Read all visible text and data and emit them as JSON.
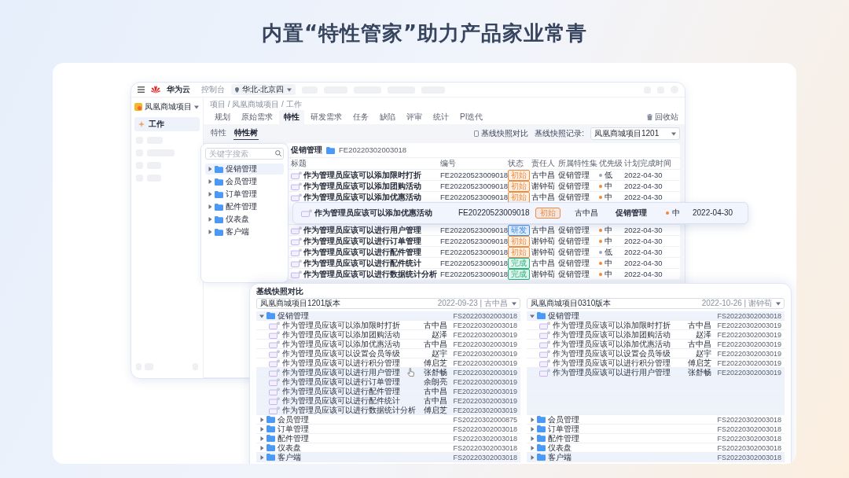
{
  "headline": "内置“特性管家”助力产品家业常青",
  "app": {
    "topbar": {
      "brand": "华为云",
      "console": "控制台",
      "region": "华北-北京四"
    },
    "sidebar": {
      "project": "凤凰商城项目",
      "items": [
        {
          "label": "工作",
          "selected": true
        }
      ]
    },
    "breadcrumb": "项目 / 凤凰商城项目 / 工作",
    "tabs": [
      {
        "label": "规划",
        "selected": false
      },
      {
        "label": "原始需求",
        "selected": false
      },
      {
        "label": "特性",
        "selected": true
      },
      {
        "label": "研发需求",
        "selected": false
      },
      {
        "label": "任务",
        "selected": false
      },
      {
        "label": "缺陷",
        "selected": false
      },
      {
        "label": "评审",
        "selected": false
      },
      {
        "label": "统计",
        "selected": false
      },
      {
        "label": "PI迭代",
        "selected": false
      }
    ],
    "recycle": "回收站",
    "subtabs": [
      {
        "label": "特性",
        "selected": false
      },
      {
        "label": "特性树",
        "selected": true
      }
    ],
    "baseline_compare": "基线快照对比",
    "baseline_record": {
      "label": "基线快照记录:",
      "value": "凤凰商城项目1201"
    },
    "tree": {
      "placeholder": "关键字搜索",
      "items": [
        {
          "label": "促销管理",
          "selected": true
        },
        {
          "label": "会员管理",
          "selected": false
        },
        {
          "label": "订单管理",
          "selected": false
        },
        {
          "label": "配件管理",
          "selected": false
        },
        {
          "label": "仪表盘",
          "selected": false
        },
        {
          "label": "客户端",
          "selected": false
        }
      ]
    },
    "detail": {
      "title": "促销管理",
      "id": "FE20220302003018",
      "columns": [
        "标题",
        "编号",
        "状态",
        "责任人",
        "所属特性集",
        "优先级",
        "计划完成时间"
      ],
      "rows": [
        {
          "kind": "feature",
          "title": "作为管理员应该可以添加限时打折",
          "id": "FE20220523009018",
          "status": {
            "label": "初始",
            "color": "#f08a3c"
          },
          "owner": "古中昌",
          "set": "促销管理",
          "priority": {
            "label": "低",
            "color": "#a0a6b3"
          },
          "due": "2022-04-30"
        },
        {
          "kind": "feature",
          "title": "作为管理员应该可以添加团购活动",
          "id": "FE20220523009018",
          "status": {
            "label": "初始",
            "color": "#f08a3c"
          },
          "owner": "谢钟荀",
          "set": "促销管理",
          "priority": {
            "label": "中",
            "color": "#f5862e"
          },
          "due": "2022-04-30"
        },
        {
          "kind": "feature",
          "title": "作为管理员应该可以添加优惠活动",
          "id": "FE20220523009018",
          "status": {
            "label": "初始",
            "color": "#f08a3c"
          },
          "owner": "古中昌",
          "set": "促销管理",
          "priority": {
            "label": "中",
            "color": "#f5862e"
          },
          "due": "2022-04-30"
        },
        {
          "kind": "covered"
        },
        {
          "kind": "covered"
        },
        {
          "kind": "feature",
          "title": "作为管理员应该可以进行用户管理",
          "id": "FE20220523009018",
          "status": {
            "label": "研发",
            "color": "#3d8ef0"
          },
          "owner": "古中昌",
          "set": "促销管理",
          "priority": {
            "label": "中",
            "color": "#f5862e"
          },
          "due": "2022-04-30"
        },
        {
          "kind": "feature",
          "title": "作为管理员应该可以进行订单管理",
          "id": "FE20220523009018",
          "status": {
            "label": "初始",
            "color": "#f08a3c"
          },
          "owner": "谢钟荀",
          "set": "促销管理",
          "priority": {
            "label": "中",
            "color": "#f5862e"
          },
          "due": "2022-04-30"
        },
        {
          "kind": "feature",
          "title": "作为管理员应该可以进行配件管理",
          "id": "FE20220523009018",
          "status": {
            "label": "初始",
            "color": "#f08a3c"
          },
          "owner": "谢钟荀",
          "set": "促销管理",
          "priority": {
            "label": "低",
            "color": "#a0a6b3"
          },
          "due": "2022-04-30"
        },
        {
          "kind": "feature",
          "title": "作为管理员应该可以进行配件统计",
          "id": "FE20220523009018",
          "status": {
            "label": "完成",
            "color": "#25b37a"
          },
          "owner": "古中昌",
          "set": "促销管理",
          "priority": {
            "label": "中",
            "color": "#f5862e"
          },
          "due": "2022-04-30"
        },
        {
          "kind": "feature",
          "title": "作为管理员应该可以进行数据统计分析",
          "id": "FE20220523009018",
          "status": {
            "label": "完成",
            "color": "#25b37a"
          },
          "owner": "谢钟荀",
          "set": "促销管理",
          "priority": {
            "label": "中",
            "color": "#f5862e"
          },
          "due": "2022-04-30"
        }
      ]
    }
  },
  "floating_row": {
    "title": "作为管理员应该可以添加优惠活动",
    "id": "FE20220523009018",
    "status": {
      "label": "初始",
      "color": "#f08a3c"
    },
    "owner": "古中昌",
    "set": "促销管理",
    "priority": {
      "label": "中",
      "color": "#f5862e"
    },
    "due": "2022-04-30"
  },
  "compare": {
    "title": "基线快照对比",
    "panes": [
      {
        "version": "凤凰商城项目1201版本",
        "meta": "2022-09-23 | 古中昌",
        "groups": [
          {
            "label": "促销管理",
            "id": "FS20220302003018",
            "expanded": true,
            "highlighted": true,
            "children": [
              {
                "kind": "item",
                "title": "作为管理员应该可以添加限时打折",
                "owner": "古中昌",
                "id": "FE20220302003018",
                "highlighted": false
              },
              {
                "kind": "item",
                "title": "作为管理员应该可以添加团购活动",
                "owner": "赵泽",
                "id": "FE20220302003019",
                "highlighted": false
              },
              {
                "kind": "item",
                "title": "作为管理员应该可以添加优惠活动",
                "owner": "古中昌",
                "id": "FE20220302003019",
                "highlighted": false
              },
              {
                "kind": "item",
                "title": "作为管理员应该可以设置会员等级",
                "owner": "赵宇",
                "id": "FE20220302003019",
                "highlighted": false
              },
              {
                "kind": "item",
                "title": "作为管理员应该可以进行积分管理",
                "owner": "傅启芝",
                "id": "FE20220302003019",
                "highlighted": false
              },
              {
                "kind": "item",
                "title": "作为管理员应该可以进行用户管理",
                "owner": "张舒畅",
                "id": "FE20220302003019",
                "highlighted": true
              },
              {
                "kind": "item",
                "title": "作为管理员应该可以进行订单管理",
                "owner": "余朗亮",
                "id": "FE20220302003019",
                "highlighted": true
              },
              {
                "kind": "item",
                "title": "作为管理员应该可以进行配件管理",
                "owner": "古中昌",
                "id": "FE20220302003019",
                "highlighted": true
              },
              {
                "kind": "item",
                "title": "作为管理员应该可以进行配件统计",
                "owner": "古中昌",
                "id": "FE20220302003019",
                "highlighted": true
              },
              {
                "kind": "item",
                "title": "作为管理员应该可以进行数据统计分析",
                "owner": "傅启芝",
                "id": "FE20220302003019",
                "highlighted": true
              }
            ]
          },
          {
            "label": "会员管理",
            "id": "FS20220302000875",
            "expanded": false,
            "highlighted": false
          },
          {
            "label": "订单管理",
            "id": "FS20220302003018",
            "expanded": false,
            "highlighted": false
          },
          {
            "label": "配件管理",
            "id": "FS20220302003018",
            "expanded": false,
            "highlighted": false
          },
          {
            "label": "仪表盘",
            "id": "FS20220302003018",
            "expanded": false,
            "highlighted": false
          },
          {
            "label": "客户端",
            "id": "FS20220302003018",
            "expanded": false,
            "highlighted": true
          }
        ]
      },
      {
        "version": "凤凰商城项目0310版本",
        "meta": "2022-10-26 | 谢钟荀",
        "groups": [
          {
            "label": "促销管理",
            "id": "FS20220302003018",
            "expanded": true,
            "highlighted": true,
            "children": [
              {
                "kind": "item",
                "title": "作为管理员应该可以添加限时打折",
                "owner": "古中昌",
                "id": "FE20220302003019",
                "highlighted": false
              },
              {
                "kind": "item",
                "title": "作为管理员应该可以添加团购活动",
                "owner": "赵泽",
                "id": "FE20220302003019",
                "highlighted": false
              },
              {
                "kind": "item",
                "title": "作为管理员应该可以添加优惠活动",
                "owner": "古中昌",
                "id": "FE20220302003019",
                "highlighted": false
              },
              {
                "kind": "item",
                "title": "作为管理员应该可以设置会员等级",
                "owner": "赵宇",
                "id": "FE20220302003019",
                "highlighted": false
              },
              {
                "kind": "item",
                "title": "作为管理员应该可以进行积分管理",
                "owner": "傅启芝",
                "id": "FE20220302003019",
                "highlighted": false
              },
              {
                "kind": "item",
                "title": "作为管理员应该可以进行用户管理",
                "owner": "张舒畅",
                "id": "FE20220302003019",
                "highlighted": true
              },
              {
                "kind": "empty",
                "highlighted": true
              },
              {
                "kind": "empty",
                "highlighted": true
              },
              {
                "kind": "empty",
                "highlighted": true
              },
              {
                "kind": "empty",
                "highlighted": true
              }
            ]
          },
          {
            "label": "会员管理",
            "id": "FS20220302003018",
            "expanded": false,
            "highlighted": false
          },
          {
            "label": "订单管理",
            "id": "FS20220302003018",
            "expanded": false,
            "highlighted": false
          },
          {
            "label": "配件管理",
            "id": "FS20220302003018",
            "expanded": false,
            "highlighted": false
          },
          {
            "label": "仪表盘",
            "id": "FS20220302003018",
            "expanded": false,
            "highlighted": false
          },
          {
            "label": "客户端",
            "id": "FS20220302003018",
            "expanded": false,
            "highlighted": true
          }
        ]
      }
    ]
  }
}
